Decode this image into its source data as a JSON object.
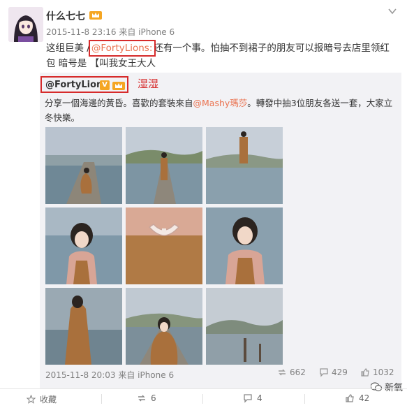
{
  "post": {
    "author": "什么七七",
    "meta": "2015-11-8 23:16 来自 iPhone 6",
    "text_before": "这组巨美 /",
    "mention": "@FortyLions:",
    "text_after": "还有一个事。怕抽不到裙子的朋友可以报暗号去店里领红包 暗号是 【叫我女王大人"
  },
  "repost": {
    "author": "@FortyLions",
    "verified": "V",
    "hand_note": "湿湿",
    "text_before": "分享一個海邊的黃昏。喜歡的套裝來自",
    "mention": "@Mashy瑪莎",
    "text_after": "。轉發中抽3位朋友各送一套，大家立冬快樂。",
    "meta": "2015-11-8 20:03 来自 iPhone 6",
    "reposts": "662",
    "comments": "429",
    "likes": "1032"
  },
  "footer": {
    "favorite": "收藏",
    "repost": "6",
    "comment": "4",
    "like": "42"
  },
  "watermark": "新氧",
  "icons": {
    "chevron": "chevron-down-icon",
    "repost": "repost-icon",
    "comment": "comment-icon",
    "like": "thumbs-up-icon",
    "favorite": "star-icon"
  },
  "colors": {
    "link": "#eb7350",
    "highlight": "#d62b2b",
    "badge": "#f5a623"
  }
}
